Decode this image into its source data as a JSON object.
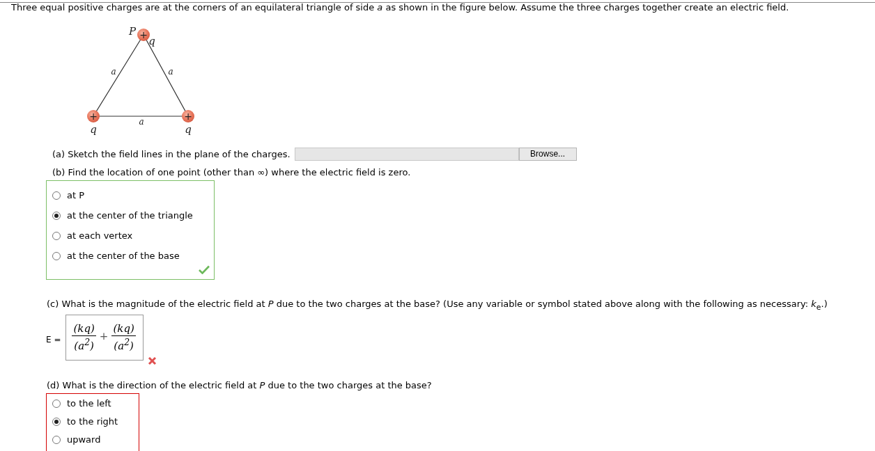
{
  "intro": "Three equal positive charges are at the corners of an equilateral triangle of side *a* as shown in the figure below. Assume the three charges together create an electric field.",
  "figure": {
    "vertex_label": "P",
    "charge_sign": "+",
    "charge_labels": [
      "q",
      "q",
      "q"
    ],
    "side_labels": [
      "a",
      "a",
      "a"
    ]
  },
  "part_a": {
    "prompt": "(a) Sketch the field lines in the plane of the charges.",
    "button": "Browse..."
  },
  "part_b": {
    "prompt": "(b) Find the location of one point (other than ∞) where the electric field is zero.",
    "correct": true,
    "options": [
      {
        "label": "at P",
        "selected": false
      },
      {
        "label": "at the center of the triangle",
        "selected": true
      },
      {
        "label": "at each vertex",
        "selected": false
      },
      {
        "label": "at the center of the base",
        "selected": false
      }
    ]
  },
  "part_c": {
    "prompt": "(c) What is the magnitude of the electric field at *P* due to the two charges at the base? (Use any variable or symbol stated above along with the following as necessary: *k*$_{e}$.)",
    "label": "E =",
    "correct": false,
    "operator": "+",
    "terms": [
      {
        "numerator": "(kq)",
        "denominator": "(a$^{2}$)"
      },
      {
        "numerator": "(kq)",
        "denominator": "(a$^{2}$)"
      }
    ]
  },
  "part_d": {
    "prompt": "(d) What is the direction of the electric field at *P* due to the two charges at the base?",
    "correct": false,
    "options": [
      {
        "label": "to the left",
        "selected": false
      },
      {
        "label": "to the right",
        "selected": true
      },
      {
        "label": "upward",
        "selected": false
      }
    ]
  }
}
